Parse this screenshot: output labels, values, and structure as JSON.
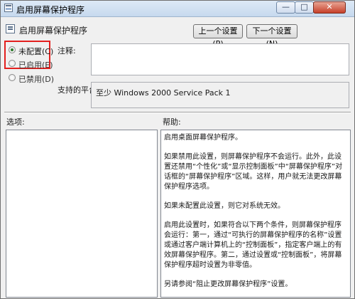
{
  "window": {
    "title": "启用屏幕保护程序"
  },
  "window_controls": {
    "minimize": "—",
    "maximize": "□",
    "close": "✕"
  },
  "policy": {
    "name": "启用屏幕保护程序"
  },
  "nav": {
    "prev": "上一个设置(P)",
    "next": "下一个设置(N)"
  },
  "state": {
    "options": [
      {
        "label": "未配置(C)",
        "checked": true
      },
      {
        "label": "已启用(E)",
        "checked": false
      },
      {
        "label": "已禁用(D)",
        "checked": false
      }
    ]
  },
  "note": {
    "label": "注释:",
    "value": ""
  },
  "platform": {
    "label": "支持的平台:",
    "value": "至少 Windows 2000 Service Pack 1"
  },
  "sections": {
    "options": "选项:",
    "help": "帮助:"
  },
  "help": {
    "paragraphs": [
      "启用桌面屏幕保护程序。",
      "如果禁用此设置，则屏幕保护程序不会运行。此外，此设置还禁用“个性化”或“显示控制面板”中“屏幕保护程序”对话框的“屏幕保护程序”区域。这样，用户就无法更改屏幕保护程序选项。",
      "如果未配置此设置，则它对系统无效。",
      "启用此设置时，如果符合以下两个条件，则屏幕保护程序会运行：第一，通过“可执行的屏幕保护程序的名称”设置或通过客户端计算机上的“控制面板”，指定客户端上的有效屏幕保护程序。第二，通过设置或“控制面板”，将屏幕保护程序超时设置为非零值。",
      "另请参阅“阻止更改屏幕保护程序”设置。"
    ]
  },
  "colors": {
    "highlight": "#e3201e",
    "window_bg": "#f0f0f0"
  }
}
